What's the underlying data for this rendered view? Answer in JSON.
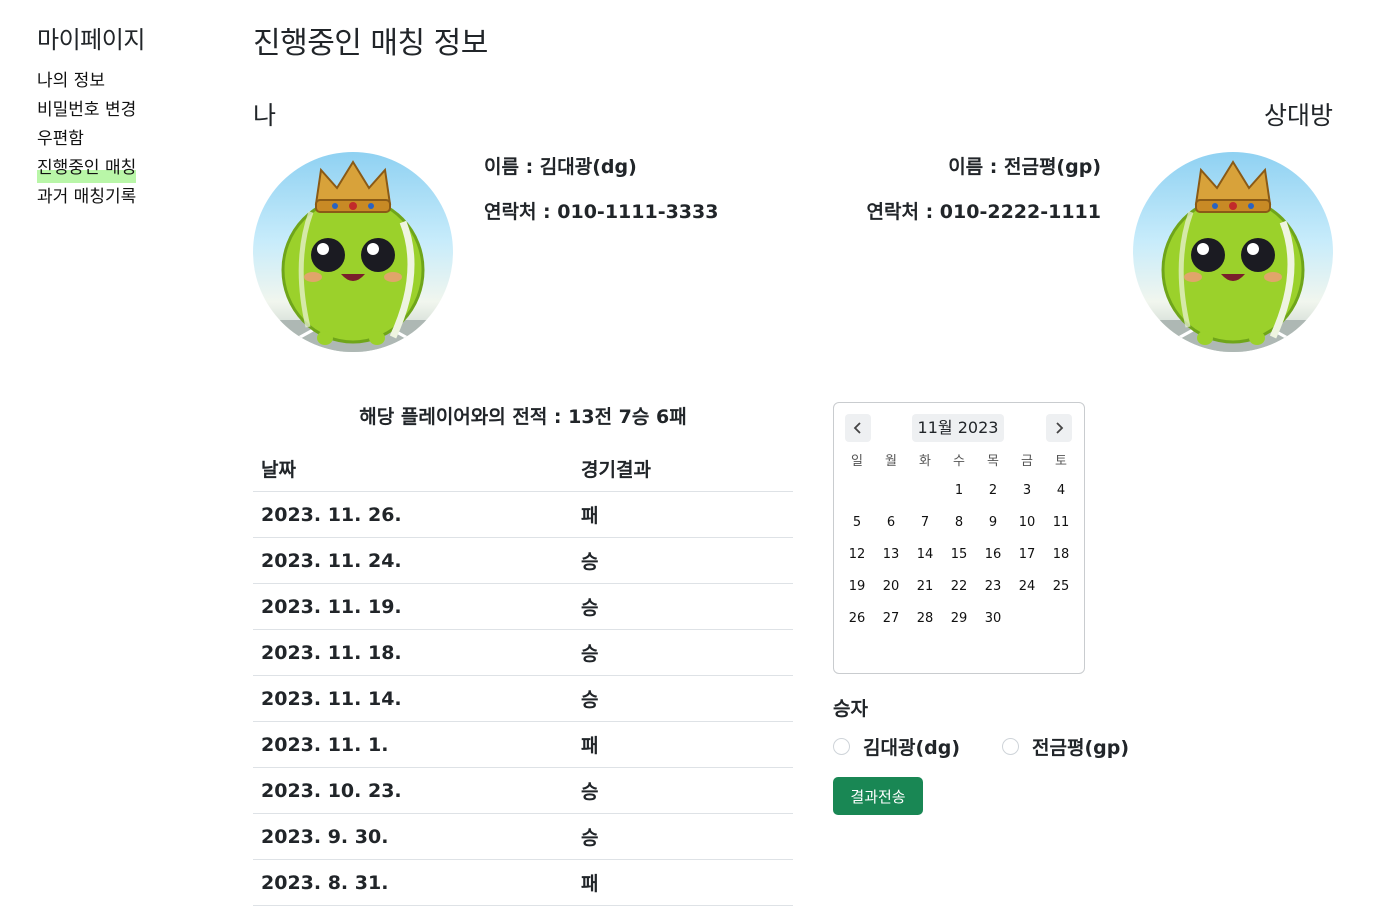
{
  "sidebar": {
    "title": "마이페이지",
    "items": [
      {
        "label": "나의 정보"
      },
      {
        "label": "비밀번호 변경"
      },
      {
        "label": "우편함"
      },
      {
        "label": "진행중인 매칭"
      },
      {
        "label": "과거 매칭기록"
      }
    ],
    "active_index": 3
  },
  "main": {
    "title": "진행중인 매칭 정보",
    "me": {
      "label": "나",
      "name_line": "이름 : 김대광(dg)",
      "contact_line": "연락처 : 010-1111-3333"
    },
    "opponent": {
      "label": "상대방",
      "name_line": "이름 : 전금평(gp)",
      "contact_line": "연락처 : 010-2222-1111"
    },
    "avatar_icon": "tennis-ball-king-avatar"
  },
  "record": {
    "summary": "해당 플레이어와의 전적 : 13전 7승 6패",
    "headers": [
      "날짜",
      "경기결과"
    ],
    "rows": [
      {
        "date": "2023. 11. 26.",
        "result": "패"
      },
      {
        "date": "2023. 11. 24.",
        "result": "승"
      },
      {
        "date": "2023. 11. 19.",
        "result": "승"
      },
      {
        "date": "2023. 11. 18.",
        "result": "승"
      },
      {
        "date": "2023. 11. 14.",
        "result": "승"
      },
      {
        "date": "2023. 11. 1.",
        "result": "패"
      },
      {
        "date": "2023. 10. 23.",
        "result": "승"
      },
      {
        "date": "2023. 9. 30.",
        "result": "승"
      },
      {
        "date": "2023. 8. 31.",
        "result": "패"
      }
    ]
  },
  "calendar": {
    "title": "11월 2023",
    "weekdays": [
      "일",
      "월",
      "화",
      "수",
      "목",
      "금",
      "토"
    ],
    "first_weekday": 3,
    "days_in_month": 30
  },
  "winner": {
    "label": "승자",
    "options": [
      "김대광(dg)",
      "전금평(gp)"
    ],
    "submit_label": "결과전송"
  },
  "colors": {
    "accent": "#198754",
    "nav_highlight": "#b9f6a8",
    "border": "#dee2e6"
  }
}
